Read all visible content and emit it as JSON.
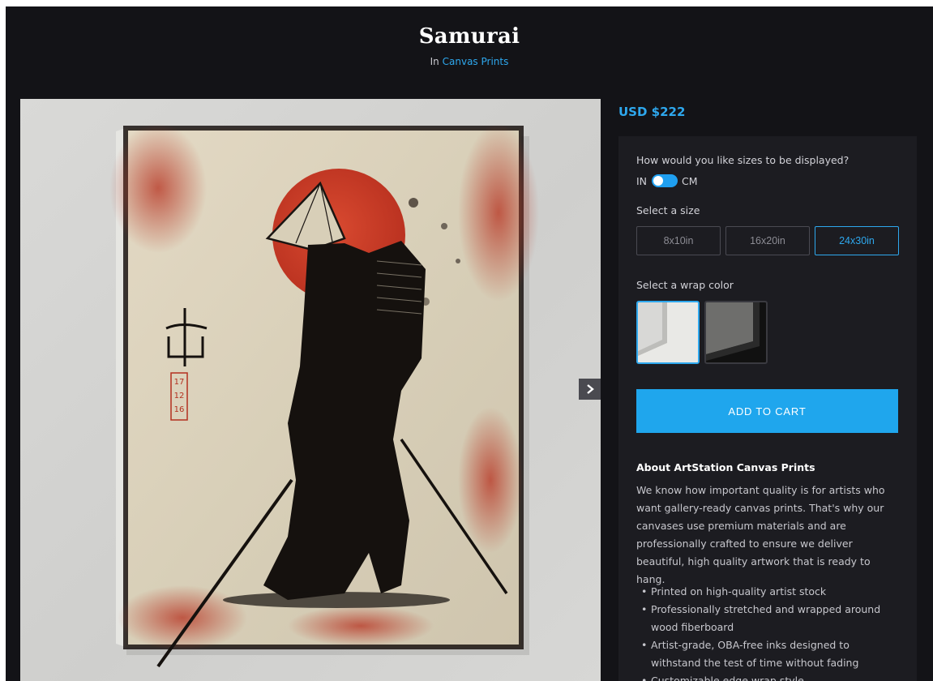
{
  "product": {
    "title": "Samurai",
    "category_prefix": "In",
    "category_link": "Canvas Prints"
  },
  "price": "USD $222",
  "options": {
    "units_question": "How would you like sizes to be displayed?",
    "unit_in": "IN",
    "unit_cm": "CM",
    "size_label": "Select a size",
    "sizes": [
      {
        "label": "8x10in",
        "selected": false
      },
      {
        "label": "16x20in",
        "selected": false
      },
      {
        "label": "24x30in",
        "selected": true
      }
    ],
    "wrap_label": "Select a wrap color",
    "wraps": [
      {
        "name": "white-wrap",
        "selected": true
      },
      {
        "name": "black-wrap",
        "selected": false
      }
    ],
    "add_to_cart": "ADD TO CART"
  },
  "about": {
    "title": "About ArtStation Canvas Prints",
    "text": "We know how important quality is for artists who want gallery-ready canvas prints. That's why our canvases use premium materials and are professionally crafted to ensure we deliver beautiful, high quality artwork that is ready to hang.",
    "features": [
      "Printed on high-quality artist stock",
      "Professionally stretched and wrapped around wood fiberboard",
      "Artist-grade, OBA-free inks designed to withstand the test of time without fading",
      "Customizable edge wrap style"
    ]
  },
  "artwork": {
    "date_stamp": [
      "17",
      "12",
      "16"
    ]
  },
  "colors": {
    "background": "#131317",
    "panel": "#1c1c21",
    "accent": "#2ea8ee",
    "sun_red": "#c83a26"
  },
  "icons": {
    "next": "chevron-right-icon"
  }
}
